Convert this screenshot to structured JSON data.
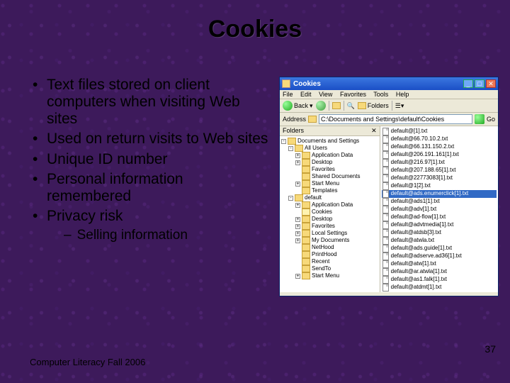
{
  "title": "Cookies",
  "bullets": [
    "Text files stored on client computers when visiting Web sites",
    "Used on return visits to Web sites",
    "Unique ID number",
    "Personal information remembered",
    "Privacy risk"
  ],
  "subbullet": "Selling information",
  "footer": "Computer Literacy Fall 2006",
  "page_number": "37",
  "window": {
    "title": "Cookies",
    "menu": [
      "File",
      "Edit",
      "View",
      "Favorites",
      "Tools",
      "Help"
    ],
    "toolbar": {
      "back": "Back",
      "folders": "Folders"
    },
    "address_label": "Address",
    "address_value": "C:\\Documents and Settings\\default\\Cookies",
    "go": "Go",
    "pane_header": "Folders",
    "tree": [
      {
        "lvl": 0,
        "pm": "-",
        "ico": "folder",
        "label": "Documents and Settings"
      },
      {
        "lvl": 1,
        "pm": "-",
        "ico": "folder",
        "label": "All Users"
      },
      {
        "lvl": 2,
        "pm": "+",
        "ico": "folder",
        "label": "Application Data"
      },
      {
        "lvl": 2,
        "pm": "+",
        "ico": "folder",
        "label": "Desktop"
      },
      {
        "lvl": 2,
        "pm": " ",
        "ico": "folder",
        "label": "Favorites"
      },
      {
        "lvl": 2,
        "pm": " ",
        "ico": "folder",
        "label": "Shared Documents"
      },
      {
        "lvl": 2,
        "pm": "+",
        "ico": "folder",
        "label": "Start Menu"
      },
      {
        "lvl": 2,
        "pm": " ",
        "ico": "folder",
        "label": "Templates"
      },
      {
        "lvl": 1,
        "pm": "-",
        "ico": "folder",
        "label": "default"
      },
      {
        "lvl": 2,
        "pm": "+",
        "ico": "folder",
        "label": "Application Data"
      },
      {
        "lvl": 2,
        "pm": " ",
        "ico": "folder-open",
        "label": "Cookies"
      },
      {
        "lvl": 2,
        "pm": "+",
        "ico": "folder",
        "label": "Desktop"
      },
      {
        "lvl": 2,
        "pm": "+",
        "ico": "folder",
        "label": "Favorites"
      },
      {
        "lvl": 2,
        "pm": "+",
        "ico": "folder",
        "label": "Local Settings"
      },
      {
        "lvl": 2,
        "pm": "+",
        "ico": "folder",
        "label": "My Documents"
      },
      {
        "lvl": 2,
        "pm": " ",
        "ico": "folder",
        "label": "NetHood"
      },
      {
        "lvl": 2,
        "pm": " ",
        "ico": "folder",
        "label": "PrintHood"
      },
      {
        "lvl": 2,
        "pm": " ",
        "ico": "folder",
        "label": "Recent"
      },
      {
        "lvl": 2,
        "pm": " ",
        "ico": "folder",
        "label": "SendTo"
      },
      {
        "lvl": 2,
        "pm": "+",
        "ico": "folder",
        "label": "Start Menu"
      }
    ],
    "files": [
      {
        "name": "default@[1].txt",
        "sel": false
      },
      {
        "name": "default@66.70.10.2.txt",
        "sel": false
      },
      {
        "name": "default@66.131.150.2.txt",
        "sel": false
      },
      {
        "name": "default@206.191.161[1].txt",
        "sel": false
      },
      {
        "name": "default@216.97[1].txt",
        "sel": false
      },
      {
        "name": "default@207.188.65[1].txt",
        "sel": false
      },
      {
        "name": "default@22773083[1].txt",
        "sel": false
      },
      {
        "name": "default@1[2].txt",
        "sel": false
      },
      {
        "name": "default@ads.enumerclick[1].txt",
        "sel": true
      },
      {
        "name": "default@ads1[1].txt",
        "sel": false
      },
      {
        "name": "default@adv[1].txt",
        "sel": false
      },
      {
        "name": "default@ad-flow[1].txt",
        "sel": false
      },
      {
        "name": "default@advtmedia[1].txt",
        "sel": false
      },
      {
        "name": "default@atdsb[3].txt",
        "sel": false
      },
      {
        "name": "default@atwla.txt",
        "sel": false
      },
      {
        "name": "default@ads.guide[1].txt",
        "sel": false
      },
      {
        "name": "default@adserve.ad36[1].txt",
        "sel": false
      },
      {
        "name": "default@atw[1].txt",
        "sel": false
      },
      {
        "name": "default@ar.atwla[1].txt",
        "sel": false
      },
      {
        "name": "default@as1.falk[1].txt",
        "sel": false
      },
      {
        "name": "default@atdmt[1].txt",
        "sel": false
      }
    ]
  }
}
